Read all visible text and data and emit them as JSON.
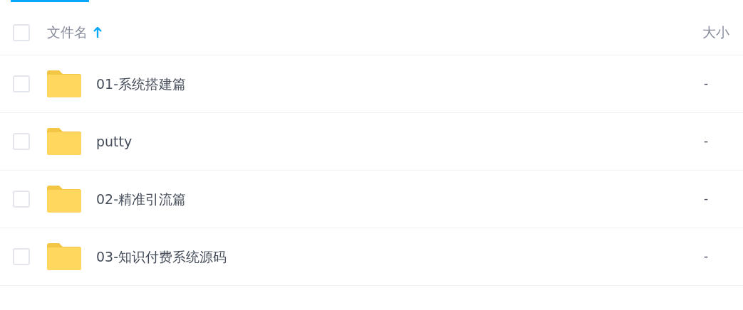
{
  "header": {
    "checked": false,
    "columns": [
      {
        "label": "文件名",
        "ascending": true
      },
      {
        "label": "大小"
      }
    ]
  },
  "rows": [
    {
      "name": "01-系统搭建篇",
      "size": "-",
      "checked": false
    },
    {
      "name": "putty",
      "size": "-",
      "checked": false
    },
    {
      "name": "02-精准引流篇",
      "size": "-",
      "checked": false
    },
    {
      "name": "03-知识付费系统源码",
      "size": "-",
      "checked": false
    }
  ]
}
